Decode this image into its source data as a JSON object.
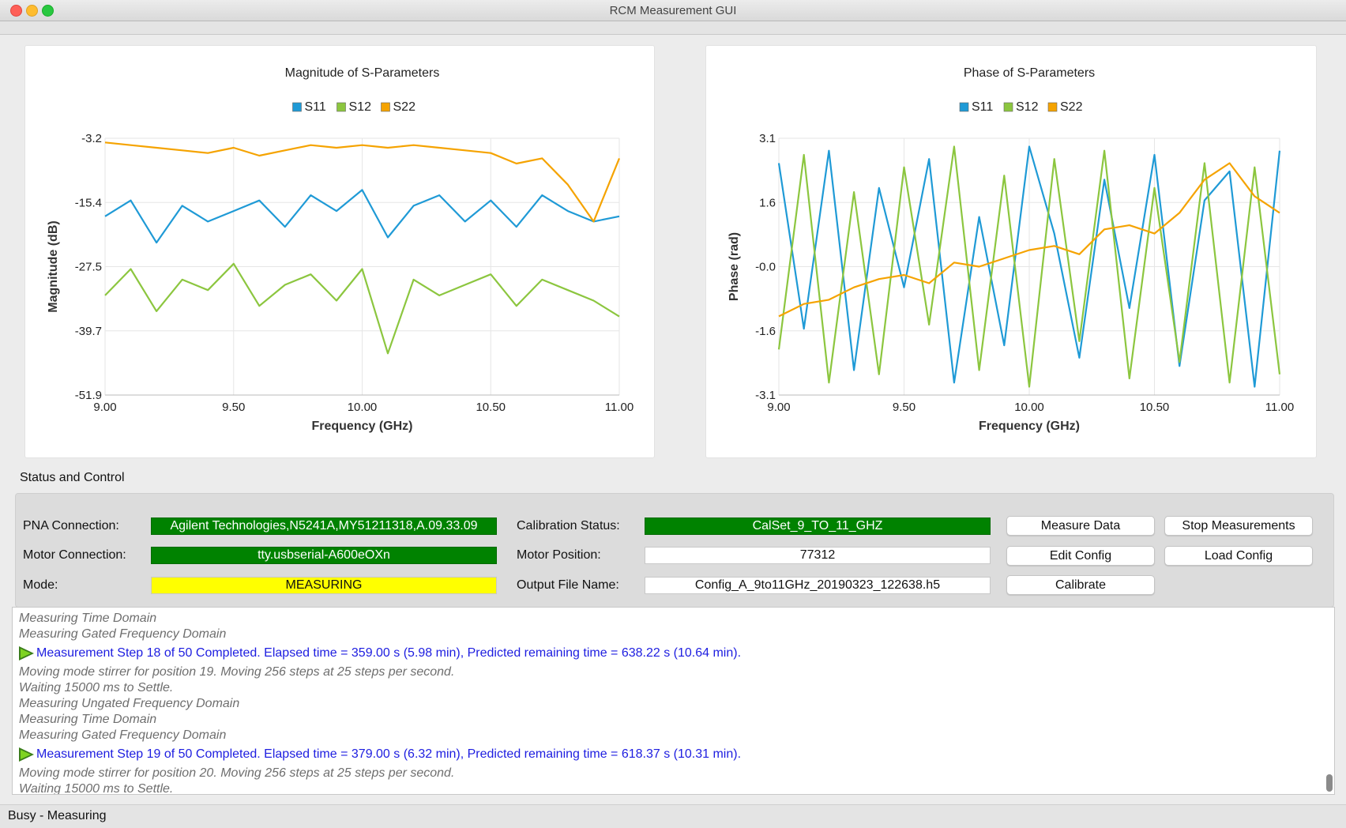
{
  "window": {
    "title": "RCM Measurement GUI"
  },
  "charts": {
    "magnitude": {
      "title": "Magnitude of S-Parameters",
      "xlabel": "Frequency (GHz)",
      "ylabel": "Magnitude (dB)",
      "yticks": [
        "-3.2",
        "-15.4",
        "-27.5",
        "-39.7",
        "-51.9"
      ],
      "xticks": [
        "9.00",
        "9.50",
        "10.00",
        "10.50",
        "11.00"
      ],
      "legend": [
        "S11",
        "S12",
        "S22"
      ]
    },
    "phase": {
      "title": "Phase of S-Parameters",
      "xlabel": "Frequency (GHz)",
      "ylabel": "Phase (rad)",
      "yticks": [
        "3.1",
        "1.6",
        "-0.0",
        "-1.6",
        "-3.1"
      ],
      "xticks": [
        "9.00",
        "9.50",
        "10.00",
        "10.50",
        "11.00"
      ],
      "legend": [
        "S11",
        "S12",
        "S22"
      ]
    }
  },
  "chart_data": [
    {
      "type": "line",
      "title": "Magnitude of S-Parameters",
      "xlabel": "Frequency (GHz)",
      "ylabel": "Magnitude (dB)",
      "xlim": [
        9.0,
        11.0
      ],
      "ylim": [
        -51.9,
        -3.2
      ],
      "grid": true,
      "legend_position": "top",
      "x": [
        9.0,
        9.1,
        9.2,
        9.3,
        9.4,
        9.5,
        9.6,
        9.7,
        9.8,
        9.9,
        10.0,
        10.1,
        10.2,
        10.3,
        10.4,
        10.5,
        10.6,
        10.7,
        10.8,
        10.9,
        11.0
      ],
      "series": [
        {
          "name": "S11",
          "color": "#1f9ad6",
          "values": [
            -18,
            -15,
            -23,
            -16,
            -19,
            -17,
            -15,
            -20,
            -14,
            -17,
            -13,
            -22,
            -16,
            -14,
            -19,
            -15,
            -20,
            -14,
            -17,
            -19,
            -18
          ]
        },
        {
          "name": "S12",
          "color": "#8cc63f",
          "values": [
            -33,
            -28,
            -36,
            -30,
            -32,
            -27,
            -35,
            -31,
            -29,
            -34,
            -28,
            -44,
            -30,
            -33,
            -31,
            -29,
            -35,
            -30,
            -32,
            -34,
            -37
          ]
        },
        {
          "name": "S22",
          "color": "#f5a300",
          "values": [
            -4,
            -4.5,
            -5,
            -5.5,
            -6,
            -5,
            -6.5,
            -5.5,
            -4.5,
            -5,
            -4.5,
            -5,
            -4.5,
            -5,
            -5.5,
            -6,
            -8,
            -7,
            -12,
            -19,
            -7
          ]
        }
      ]
    },
    {
      "type": "line",
      "title": "Phase of S-Parameters",
      "xlabel": "Frequency (GHz)",
      "ylabel": "Phase (rad)",
      "xlim": [
        9.0,
        11.0
      ],
      "ylim": [
        -3.1,
        3.1
      ],
      "grid": true,
      "legend_position": "top",
      "x": [
        9.0,
        9.1,
        9.2,
        9.3,
        9.4,
        9.5,
        9.6,
        9.7,
        9.8,
        9.9,
        10.0,
        10.1,
        10.2,
        10.3,
        10.4,
        10.5,
        10.6,
        10.7,
        10.8,
        10.9,
        11.0
      ],
      "series": [
        {
          "name": "S11",
          "color": "#1f9ad6",
          "values": [
            2.5,
            -1.5,
            2.8,
            -2.5,
            1.9,
            -0.5,
            2.6,
            -2.8,
            1.2,
            -1.9,
            2.9,
            0.8,
            -2.2,
            2.1,
            -1.0,
            2.7,
            -2.4,
            1.6,
            2.3,
            -2.9,
            2.8
          ]
        },
        {
          "name": "S12",
          "color": "#8cc63f",
          "values": [
            -2.0,
            2.7,
            -2.8,
            1.8,
            -2.6,
            2.4,
            -1.4,
            2.9,
            -2.5,
            2.2,
            -2.9,
            2.6,
            -1.8,
            2.8,
            -2.7,
            1.9,
            -2.3,
            2.5,
            -2.8,
            2.4,
            -2.6
          ]
        },
        {
          "name": "S22",
          "color": "#f5a300",
          "values": [
            -1.2,
            -0.9,
            -0.8,
            -0.5,
            -0.3,
            -0.2,
            -0.4,
            0.1,
            0.0,
            0.2,
            0.4,
            0.5,
            0.3,
            0.9,
            1.0,
            0.8,
            1.3,
            2.1,
            2.5,
            1.7,
            1.3
          ]
        }
      ]
    }
  ],
  "status": {
    "section_title": "Status and Control",
    "pna_label": "PNA Connection:",
    "pna_value": "Agilent Technologies,N5241A,MY51211318,A.09.33.09",
    "motor_label": "Motor Connection:",
    "motor_value": "tty.usbserial-A600eOXn",
    "mode_label": "Mode:",
    "mode_value": "MEASURING",
    "cal_label": "Calibration Status:",
    "cal_value": "CalSet_9_TO_11_GHZ",
    "position_label": "Motor Position:",
    "position_value": "77312",
    "output_label": "Output File Name:",
    "output_value": "Config_A_9to11GHz_20190323_122638.h5",
    "colors": {
      "connected": "#008200",
      "mode": "#ffff00"
    }
  },
  "buttons": {
    "measure": "Measure Data",
    "stop": "Stop Measurements",
    "edit": "Edit Config",
    "load": "Load Config",
    "calibrate": "Calibrate"
  },
  "log": [
    {
      "kind": "info",
      "text": "Measuring Time Domain"
    },
    {
      "kind": "info",
      "text": "Measuring Gated Frequency Domain"
    },
    {
      "kind": "step",
      "text": "Measurement Step 18 of 50 Completed. Elapsed time = 359.00 s (5.98 min), Predicted remaining time = 638.22 s (10.64 min)."
    },
    {
      "kind": "info",
      "text": "Moving mode stirrer for position 19. Moving 256 steps at 25 steps per second."
    },
    {
      "kind": "info",
      "text": "Waiting 15000 ms to Settle."
    },
    {
      "kind": "info",
      "text": "Measuring Ungated Frequency Domain"
    },
    {
      "kind": "info",
      "text": "Measuring Time Domain"
    },
    {
      "kind": "info",
      "text": "Measuring Gated Frequency Domain"
    },
    {
      "kind": "step",
      "text": "Measurement Step 19 of 50 Completed. Elapsed time = 379.00 s (6.32 min), Predicted remaining time = 618.37 s (10.31 min)."
    },
    {
      "kind": "info",
      "text": "Moving mode stirrer for position 20. Moving 256 steps at 25 steps per second."
    },
    {
      "kind": "info",
      "text": "Waiting 15000 ms to Settle."
    }
  ],
  "statusbar": {
    "text": "Busy - Measuring"
  }
}
